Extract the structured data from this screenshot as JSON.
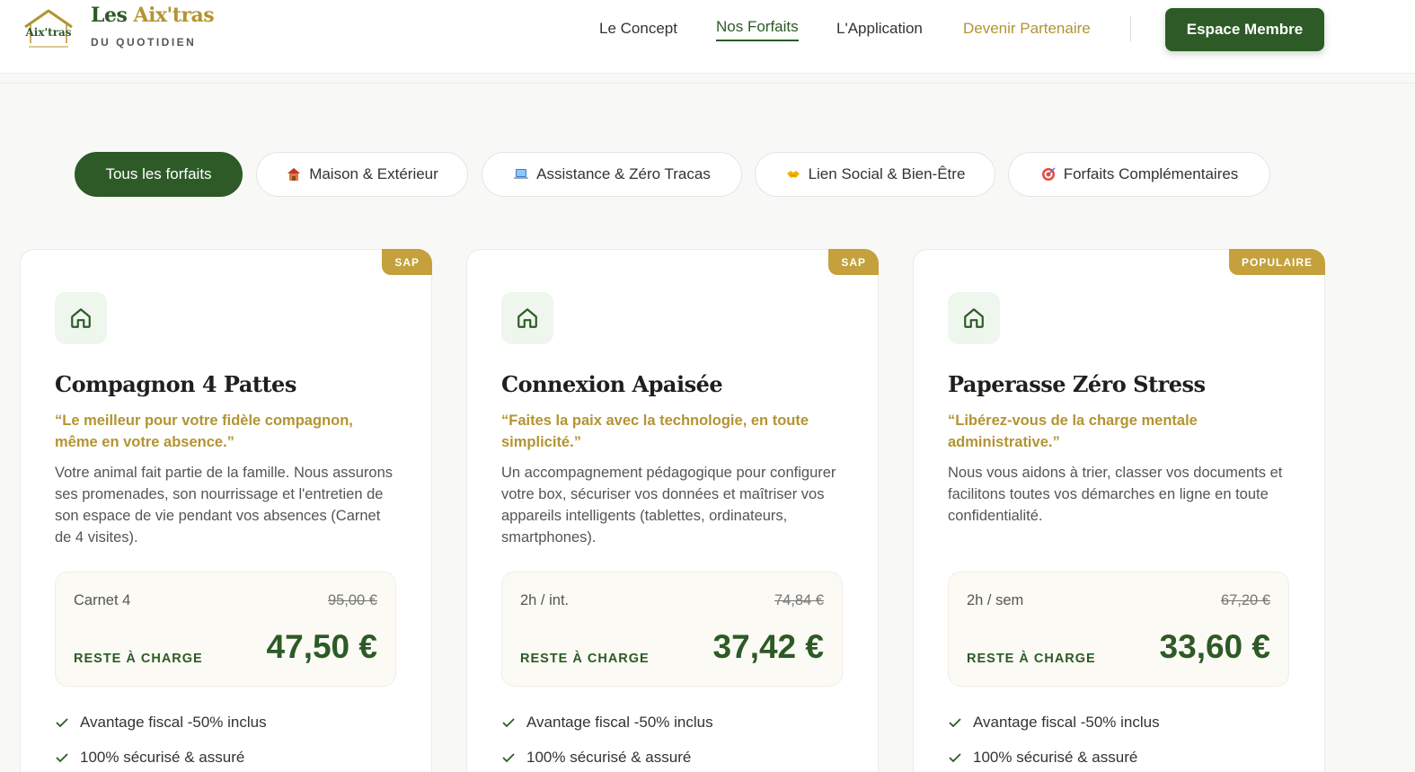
{
  "header": {
    "logo_title_main": "Les ",
    "logo_title_accent": "Aix'tras",
    "logo_subtitle": "DU QUOTIDIEN",
    "logo_mark_text": "Aix'tras",
    "nav": [
      {
        "label": "Le Concept"
      },
      {
        "label": "Nos Forfaits"
      },
      {
        "label": "L'Application"
      },
      {
        "label": "Devenir Partenaire"
      }
    ],
    "member_button": "Espace Membre"
  },
  "filters": [
    {
      "label": "Tous les forfaits",
      "icon": "",
      "active": true
    },
    {
      "label": "Maison & Extérieur",
      "icon": "house-icon"
    },
    {
      "label": "Assistance & Zéro Tracas",
      "icon": "laptop-icon"
    },
    {
      "label": "Lien Social & Bien-Être",
      "icon": "handshake-icon"
    },
    {
      "label": "Forfaits Complémentaires",
      "icon": "target-icon"
    }
  ],
  "cards": [
    {
      "badge": "SAP",
      "title": "Compagnon 4 Pattes",
      "quote": "“Le meilleur pour votre fidèle compagnon, même en votre absence.”",
      "description": "Votre animal fait partie de la famille. Nous assurons ses promenades, son nourrissage et l'entretien de son espace de vie pendant vos absences (Carnet de 4 visites).",
      "unit": "Carnet 4",
      "old_price": "95,00 €",
      "charge_label": "RESTE À CHARGE",
      "price": "47,50 €",
      "features": [
        "Avantage fiscal -50% inclus",
        "100% sécurisé & assuré"
      ]
    },
    {
      "badge": "SAP",
      "title": "Connexion Apaisée",
      "quote": "“Faites la paix avec la technologie, en toute simplicité.”",
      "description": "Un accompagnement pédagogique pour configurer votre box, sécuriser vos données et maîtriser vos appareils intelligents (tablettes, ordinateurs, smartphones).",
      "unit": "2h / int.",
      "old_price": "74,84 €",
      "charge_label": "RESTE À CHARGE",
      "price": "37,42 €",
      "features": [
        "Avantage fiscal -50% inclus",
        "100% sécurisé & assuré"
      ]
    },
    {
      "badge": "POPULAIRE",
      "title": "Paperasse Zéro Stress",
      "quote": "“Libérez-vous de la charge mentale administrative.”",
      "description": "Nous vous aidons à trier, classer vos documents et facilitons toutes vos démarches en ligne en toute confidentialité.",
      "unit": "2h / sem",
      "old_price": "67,20 €",
      "charge_label": "RESTE À CHARGE",
      "price": "33,60 €",
      "features": [
        "Avantage fiscal -50% inclus",
        "100% sécurisé & assuré"
      ]
    }
  ],
  "colors": {
    "brand_green": "#2d5a27",
    "brand_gold": "#b39433",
    "badge_gold": "#c4a13c"
  }
}
